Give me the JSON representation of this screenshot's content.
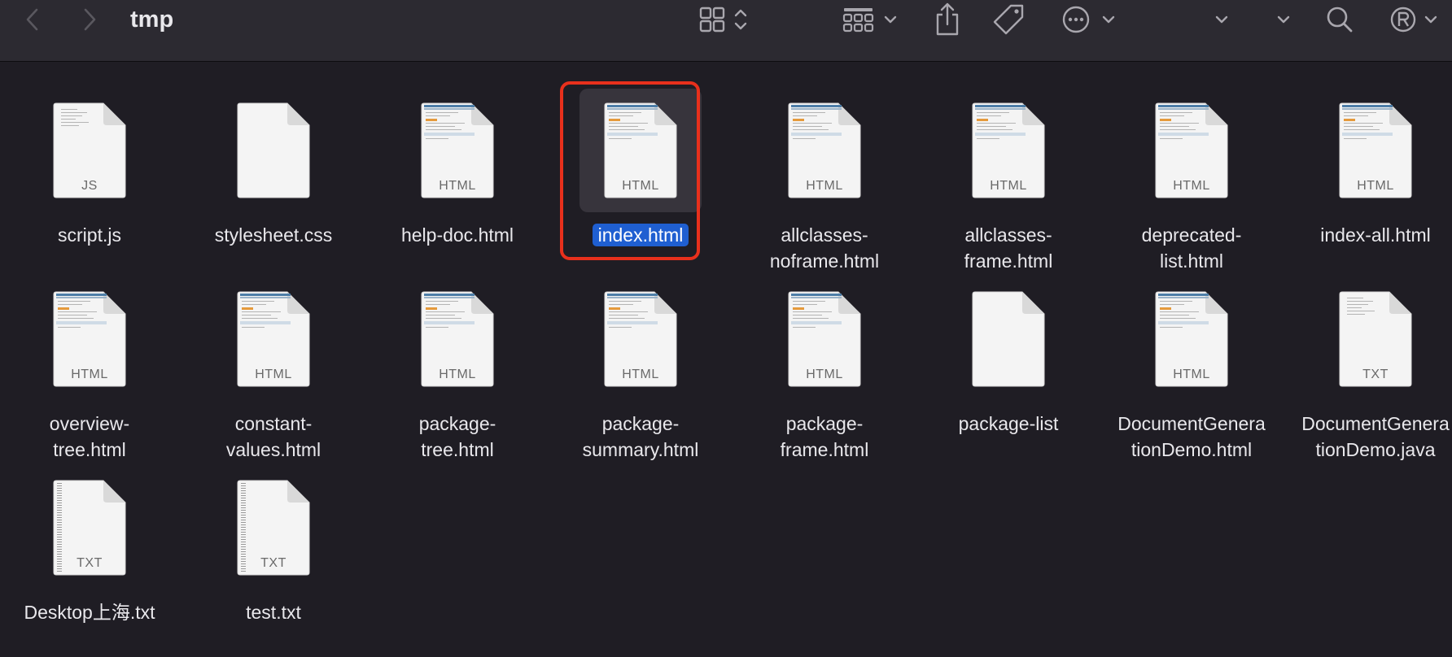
{
  "window": {
    "folder_title": "tmp"
  },
  "toolbar": {
    "back_icon": "chevron-left-icon",
    "forward_icon": "chevron-right-icon",
    "view_icon": "grid-view-icon",
    "group_icon": "group-by-icon",
    "share_icon": "share-icon",
    "tag_icon": "tag-icon",
    "more_icon": "more-actions-icon",
    "search_icon": "search-icon",
    "profile_icon": "registered-icon"
  },
  "colors": {
    "background": "#1f1d24",
    "toolbar": "#2c2a31",
    "selection_highlight": "#1f5fd1",
    "annotation_box": "#e8301c"
  },
  "files": [
    {
      "name": "script.js",
      "type": "JS",
      "icon": "js-file-icon"
    },
    {
      "name": "stylesheet.css",
      "type": "",
      "icon": "css-file-icon"
    },
    {
      "name": "help-doc.html",
      "type": "HTML",
      "icon": "html-file-icon"
    },
    {
      "name": "index.html",
      "type": "HTML",
      "icon": "html-file-icon",
      "selected": true
    },
    {
      "name": "allclasses-\nnoframe.html",
      "type": "HTML",
      "icon": "html-file-icon"
    },
    {
      "name": "allclasses-\nframe.html",
      "type": "HTML",
      "icon": "html-file-icon"
    },
    {
      "name": "deprecated-\nlist.html",
      "type": "HTML",
      "icon": "html-file-icon"
    },
    {
      "name": "index-all.html",
      "type": "HTML",
      "icon": "html-file-icon"
    },
    {
      "name": "overview-\ntree.html",
      "type": "HTML",
      "icon": "html-file-icon"
    },
    {
      "name": "constant-\nvalues.html",
      "type": "HTML",
      "icon": "html-file-icon"
    },
    {
      "name": "package-\ntree.html",
      "type": "HTML",
      "icon": "html-file-icon"
    },
    {
      "name": "package-\nsummary.html",
      "type": "HTML",
      "icon": "html-file-icon"
    },
    {
      "name": "package-\nframe.html",
      "type": "HTML",
      "icon": "html-file-icon"
    },
    {
      "name": "package-list",
      "type": "",
      "icon": "generic-file-icon"
    },
    {
      "name": "DocumentGenera\ntionDemo.html",
      "type": "HTML",
      "icon": "html-file-icon"
    },
    {
      "name": "DocumentGenera\ntionDemo.java",
      "type": "TXT",
      "icon": "java-file-icon"
    },
    {
      "name": "Desktop上海.txt",
      "type": "TXT",
      "icon": "txt-file-icon"
    },
    {
      "name": "test.txt",
      "type": "TXT",
      "icon": "txt-file-icon"
    }
  ]
}
